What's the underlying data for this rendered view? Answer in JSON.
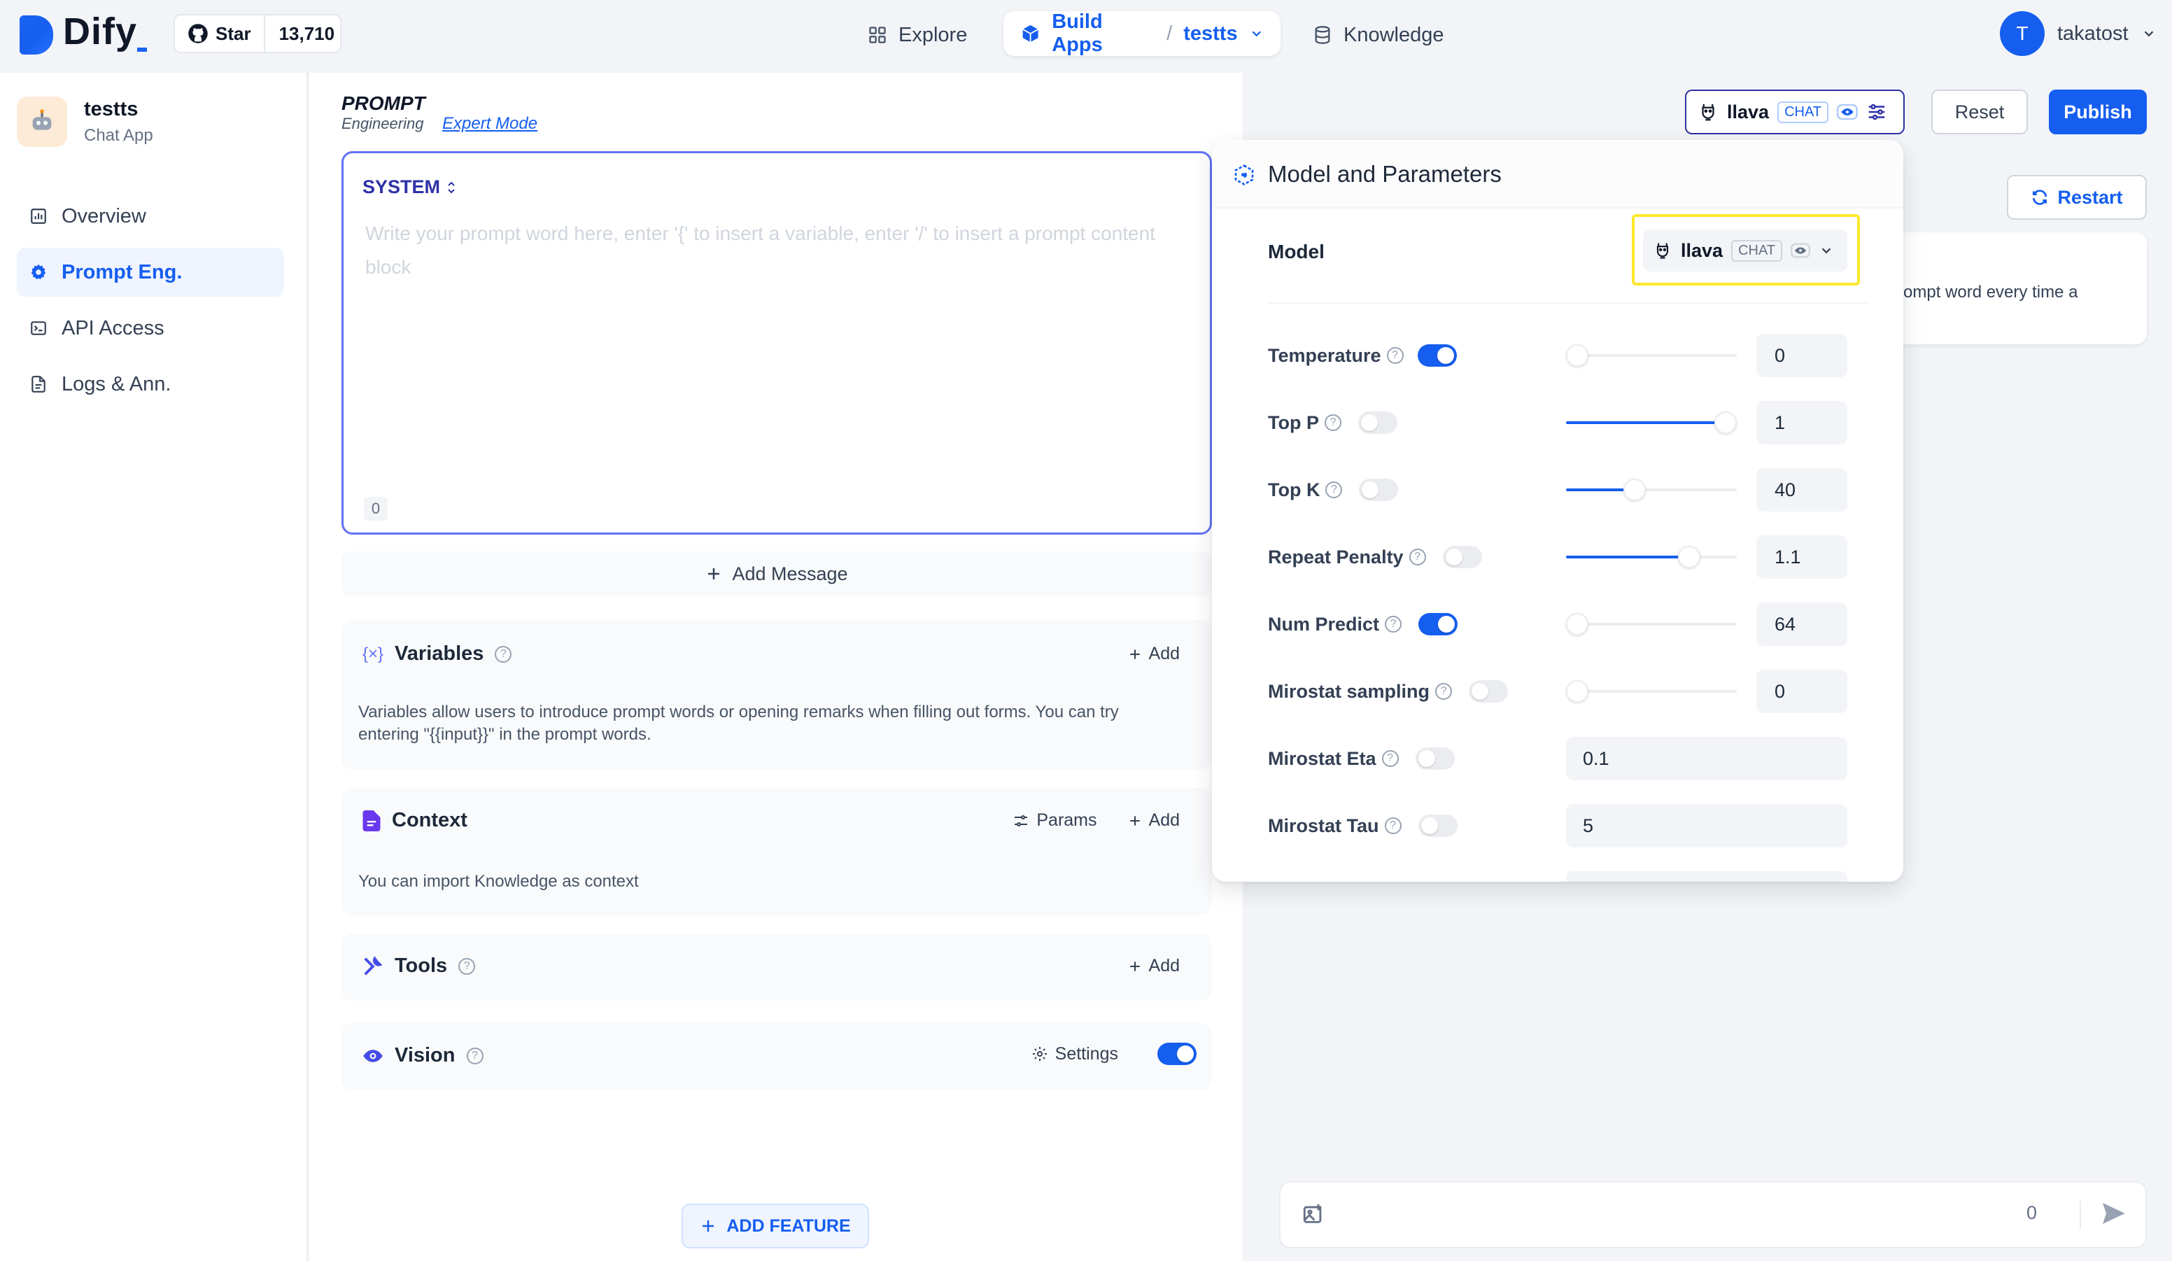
{
  "header": {
    "brand": "Dify",
    "github": {
      "star_label": "Star",
      "count": "13,710"
    },
    "nav": {
      "explore": "Explore",
      "build_apps": "Build Apps",
      "separator": "/",
      "current_app": "testts",
      "knowledge": "Knowledge"
    },
    "user": {
      "initial": "T",
      "name": "takatost"
    }
  },
  "sidebar": {
    "app": {
      "name": "testts",
      "type": "Chat App",
      "icon": "robot-emoji"
    },
    "items": [
      {
        "label": "Overview",
        "icon": "chart-icon"
      },
      {
        "label": "Prompt Eng.",
        "icon": "gear-icon",
        "active": true
      },
      {
        "label": "API Access",
        "icon": "terminal-icon"
      },
      {
        "label": "Logs & Ann.",
        "icon": "document-icon"
      }
    ]
  },
  "main": {
    "prompt_title": "PROMPT",
    "prompt_subtitle": "Engineering",
    "expert_mode": "Expert Mode",
    "system_label": "SYSTEM",
    "system_placeholder": "Write your prompt word here, enter '{' to insert a variable, enter '/' to insert a prompt content block",
    "char_count": "0",
    "add_message": "Add Message",
    "variables": {
      "title": "Variables",
      "add": "Add",
      "description": "Variables allow users to introduce prompt words or opening remarks when filling out forms. You can try entering \"{{input}}\" in the prompt words."
    },
    "context": {
      "title": "Context",
      "params": "Params",
      "add": "Add",
      "description": "You can import Knowledge as context"
    },
    "tools": {
      "title": "Tools",
      "add": "Add"
    },
    "vision": {
      "title": "Vision",
      "settings": "Settings",
      "enabled": true
    },
    "add_feature": "ADD FEATURE"
  },
  "toolbar": {
    "model_name": "llava",
    "model_tag": "CHAT",
    "reset": "Reset",
    "publish": "Publish"
  },
  "debug": {
    "restart": "Restart",
    "card_text": "ompt word every time a",
    "input_count": "0"
  },
  "model_popup": {
    "title": "Model and Parameters",
    "model_label": "Model",
    "model_name": "llava",
    "model_tag": "CHAT",
    "params": [
      {
        "label": "Temperature",
        "enabled": true,
        "slider": 0.0,
        "value": "0"
      },
      {
        "label": "Top P",
        "enabled": false,
        "slider": 1.0,
        "value": "1"
      },
      {
        "label": "Top K",
        "enabled": false,
        "slider": 0.4,
        "value": "40"
      },
      {
        "label": "Repeat Penalty",
        "enabled": false,
        "slider": 0.72,
        "value": "1.1"
      },
      {
        "label": "Num Predict",
        "enabled": true,
        "slider": 0.0,
        "value": "64"
      },
      {
        "label": "Mirostat sampling",
        "enabled": false,
        "slider": 0.0,
        "value": "0"
      },
      {
        "label": "Mirostat Eta",
        "enabled": false,
        "value": "0.1"
      },
      {
        "label": "Mirostat Tau",
        "enabled": false,
        "value": "5"
      }
    ]
  },
  "colors": {
    "accent": "#155eef",
    "highlight": "#fde82b",
    "prompt_border": "#6172f3"
  }
}
